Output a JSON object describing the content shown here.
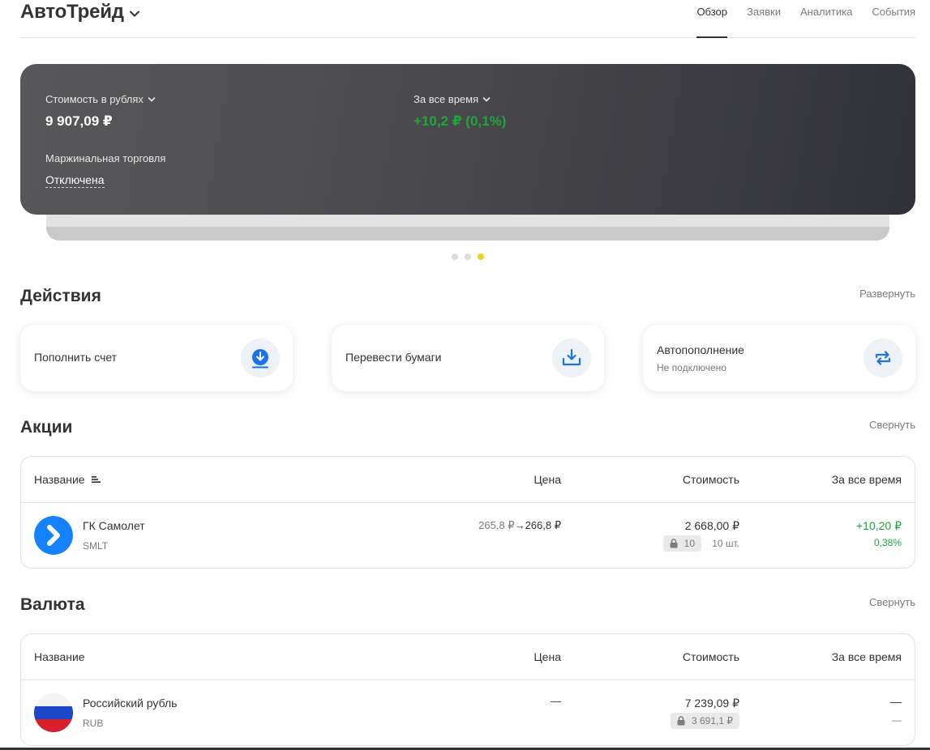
{
  "header": {
    "account_title": "АвтоТрейд",
    "nav": [
      {
        "label": "Обзор",
        "active": true
      },
      {
        "label": "Заявки",
        "active": false
      },
      {
        "label": "Аналитика",
        "active": false
      },
      {
        "label": "События",
        "active": false
      }
    ]
  },
  "balance_card": {
    "value_label": "Стоимость в рублях",
    "value": "9 907,09 ₽",
    "period_label": "За все время",
    "period_gain": "+10,2 ₽ (0,1%)",
    "margin_label": "Маржинальная торговля",
    "margin_status": "Отключена",
    "slides": 3,
    "active_slide": 3
  },
  "actions": {
    "title": "Действия",
    "expand_label": "Развернуть",
    "items": [
      {
        "label": "Пополнить счет",
        "icon": "deposit-icon"
      },
      {
        "label": "Перевести бумаги",
        "icon": "transfer-securities-icon"
      },
      {
        "label": "Автопополнение",
        "sub": "Не подключено",
        "icon": "auto-refill-icon"
      }
    ]
  },
  "stocks": {
    "title": "Акции",
    "collapse_label": "Свернуть",
    "columns": [
      "Название",
      "Цена",
      "Стоимость",
      "За все время"
    ],
    "rows": [
      {
        "name": "ГК Самолет",
        "ticker": "SMLT",
        "price_from": "265,8 ₽",
        "price_arrow": "→",
        "price_to": "266,8 ₽",
        "cost": "2 668,00 ₽",
        "locked": "10",
        "qty": "10 шт.",
        "gain": "+10,20 ₽",
        "gain_pct": "0,38%"
      }
    ]
  },
  "currency": {
    "title": "Валюта",
    "collapse_label": "Свернуть",
    "columns": [
      "Название",
      "Цена",
      "Стоимость",
      "За все время"
    ],
    "rows": [
      {
        "name": "Российский рубль",
        "ticker": "RUB",
        "price": "—",
        "cost": "7 239,09 ₽",
        "locked": "3 691,1 ₽",
        "gain": "—",
        "gain_pct": "—"
      }
    ]
  },
  "colors": {
    "accent_green": "#1fa63a",
    "dot_active": "#f5d11a",
    "icon_blue": "#1a73e8",
    "samolet_blue": "#1482ff"
  }
}
